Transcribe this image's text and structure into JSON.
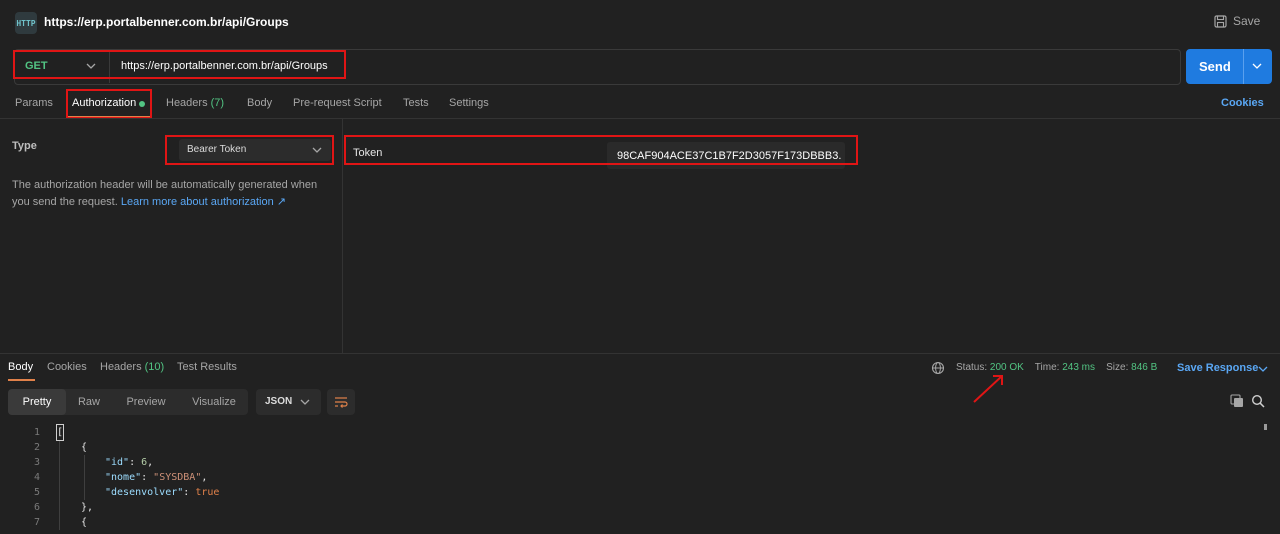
{
  "title_bar": {
    "icon_text": "HTTP",
    "url": "https://erp.portalbenner.com.br/api/Groups",
    "save_label": "Save"
  },
  "request": {
    "method": "GET",
    "url": "https://erp.portalbenner.com.br/api/Groups",
    "send_label": "Send"
  },
  "tabs": [
    {
      "label": "Params"
    },
    {
      "label": "Authorization"
    },
    {
      "label": "Headers",
      "count": "(7)"
    },
    {
      "label": "Body"
    },
    {
      "label": "Pre-request Script"
    },
    {
      "label": "Tests"
    },
    {
      "label": "Settings"
    }
  ],
  "cookies_label": "Cookies",
  "auth": {
    "type_label": "Type",
    "type_value": "Bearer Token",
    "help_text": "The authorization header will be automatically generated when you send the request.",
    "help_link": "Learn more about authorization ↗",
    "token_label": "Token",
    "token_value": "98CAF904ACE37C1B7F2D3057F173DBBB3..."
  },
  "response": {
    "tabs": [
      {
        "label": "Body"
      },
      {
        "label": "Cookies"
      },
      {
        "label": "Headers",
        "count": "(10)"
      },
      {
        "label": "Test Results"
      }
    ],
    "status_label": "Status:",
    "status_value": "200 OK",
    "time_label": "Time:",
    "time_value": "243 ms",
    "size_label": "Size:",
    "size_value": "846 B",
    "save_response_label": "Save Response",
    "view_modes": [
      "Pretty",
      "Raw",
      "Preview",
      "Visualize"
    ],
    "format": "JSON",
    "line_numbers": [
      "1",
      "2",
      "3",
      "4",
      "5",
      "6",
      "7"
    ],
    "code": {
      "l1": "[",
      "l2": "{",
      "l3_key": "\"id\"",
      "l3_val": "6",
      "l4_key": "\"nome\"",
      "l4_val": "\"SYSDBA\"",
      "l5_key": "\"desenvolver\"",
      "l5_val": "true",
      "l6": "},",
      "l7": "{"
    }
  },
  "colors": {
    "accent_send": "#1f7be0",
    "status_ok": "#52c483",
    "annotation": "#e01515"
  }
}
